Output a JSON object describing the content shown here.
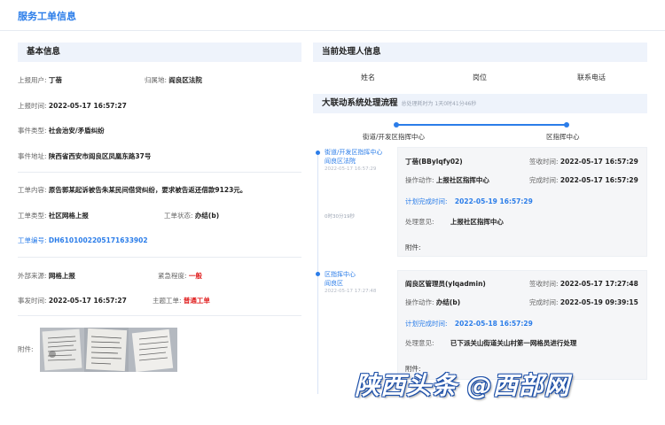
{
  "page_title": "服务工单信息",
  "basic": {
    "header": "基本信息",
    "reporter_label": "上报用户:",
    "reporter": "丁蓓",
    "area_label": "归属地:",
    "area": "阎良区法院",
    "report_time_label": "上报时间:",
    "report_time": "2022-05-17 16:57:27",
    "event_type_label": "事件类型:",
    "event_type": "社会治安/矛盾纠纷",
    "address_label": "事件地址:",
    "address": "陕西省西安市阎良区凤凰东路37号",
    "content_label": "工单内容:",
    "content": "原告郭某起诉被告朱某民间借贷纠纷，要求被告返还借款9123元。",
    "order_type_label": "工单类型:",
    "order_type": "社区网格上报",
    "status_label": "工单状态:",
    "status": "办结(b)",
    "order_no_label": "工单编号:",
    "order_no": "DH6101002205171633902",
    "source_label": "外部来源:",
    "source": "网格上报",
    "urgency_label": "紧急程度:",
    "urgency": "一般",
    "dispatch_time_label": "事发时间:",
    "dispatch_time": "2022-05-17 16:57:27",
    "theme_label": "主题工单:",
    "theme": "普通工单",
    "attach_label": "附件:"
  },
  "handler": {
    "header": "当前处理人信息",
    "col_name": "姓名",
    "col_post": "岗位",
    "col_phone": "联系电话"
  },
  "flow": {
    "header": "大联动系统处理流程",
    "sub": "总处理耗时为 1天0时41分46秒",
    "step1": "街道/开发区指挥中心",
    "step2": "区指挥中心",
    "timeline": [
      {
        "title1": "街道/开发区指挥中心",
        "title2": "阎良区法院",
        "time": "2022-05-17 16:57:29",
        "duration": "0时30分19秒"
      },
      {
        "title1": "区指挥中心",
        "title2": "阎良区",
        "time": "2022-05-17 17:27:48"
      }
    ],
    "cards": [
      {
        "name": "丁蓓(BBylqfy02)",
        "sign_label": "签收时间:",
        "sign": "2022-05-17 16:57:29",
        "action_label": "操作动作:",
        "action": "上报社区指挥中心",
        "done_label": "完成时间:",
        "done": "2022-05-17 16:57:29",
        "plan_label": "计划完成时间:",
        "plan": "2022-05-19 16:57:29",
        "opinion_label": "处理意见:",
        "opinion": "上报社区指挥中心",
        "attach_label": "附件:"
      },
      {
        "name": "阎良区管理员(ylqadmin)",
        "sign_label": "签收时间:",
        "sign": "2022-05-17 17:27:48",
        "action_label": "操作动作:",
        "action": "办结(b)",
        "done_label": "完成时间:",
        "done": "2022-05-19 09:39:15",
        "plan_label": "计划完成时间:",
        "plan": "2022-05-18 16:57:29",
        "opinion_label": "处理意见:",
        "opinion": "已下派关山街道关山村第一网格员进行处理",
        "attach_label": "附件:"
      }
    ]
  },
  "watermark": "陕西头条 @西部网",
  "colors": {
    "accent": "#2b7de9",
    "danger": "#e02020",
    "section_bg": "#eef3fb"
  }
}
